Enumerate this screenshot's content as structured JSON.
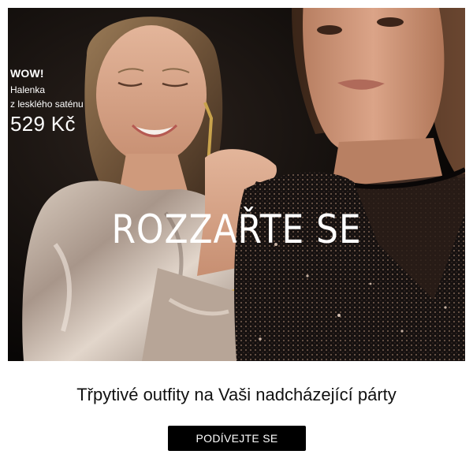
{
  "hero": {
    "promo": {
      "tag": "WOW!",
      "product_line1": "Halenka",
      "product_line2": "z lesklého saténu",
      "price": "529 Kč"
    },
    "headline": "ROZZAŘTE SE"
  },
  "subtitle": "Třpytivé outfity na Vaši nadcházející párty",
  "cta_label": "PODÍVEJTE SE",
  "colors": {
    "hero_background": "#0c0907",
    "satin_blouse": "#b9a89a",
    "sequin_top": "#1a1412",
    "button_background": "#000000",
    "text_dark": "#111111"
  }
}
